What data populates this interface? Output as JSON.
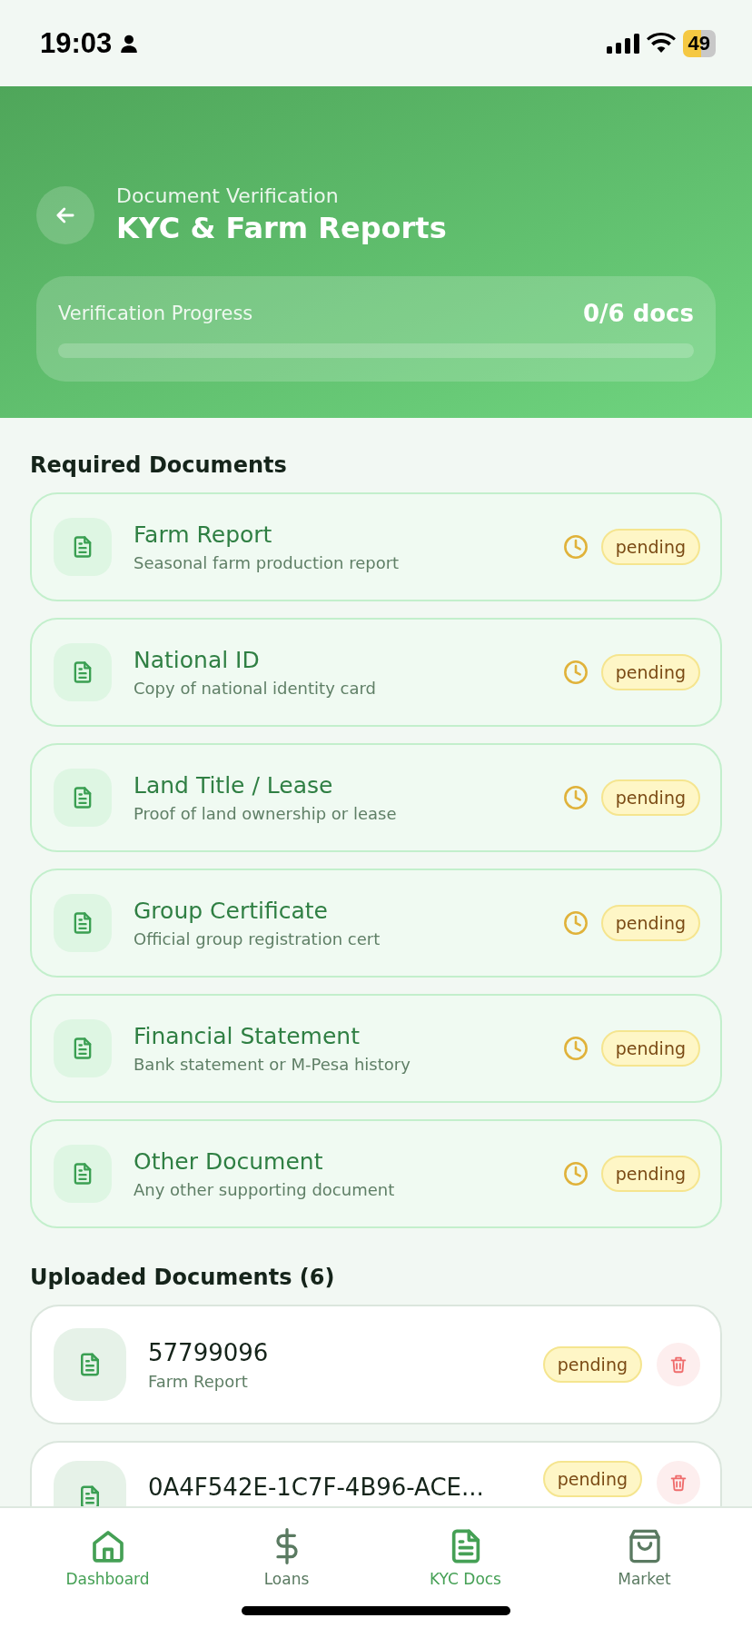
{
  "status_bar": {
    "time": "19:03",
    "battery": "49"
  },
  "header": {
    "subtitle": "Document Verification",
    "title": "KYC & Farm Reports"
  },
  "progress": {
    "label": "Verification Progress",
    "count": "0/6 docs",
    "level": 0
  },
  "required_section": {
    "title": "Required Documents"
  },
  "required_documents": [
    {
      "title": "Farm Report",
      "description": "Seasonal farm production report",
      "status": "pending"
    },
    {
      "title": "National ID",
      "description": "Copy of national identity card",
      "status": "pending"
    },
    {
      "title": "Land Title / Lease",
      "description": "Proof of land ownership or lease",
      "status": "pending"
    },
    {
      "title": "Group Certificate",
      "description": "Official group registration cert",
      "status": "pending"
    },
    {
      "title": "Financial Statement",
      "description": "Bank statement or M-Pesa history",
      "status": "pending"
    },
    {
      "title": "Other Document",
      "description": "Any other supporting document",
      "status": "pending"
    }
  ],
  "uploaded_section": {
    "title": "Uploaded Documents (6)"
  },
  "uploaded_documents": [
    {
      "name": "57799096",
      "type": "Farm Report",
      "status": "pending"
    },
    {
      "name": "0A4F542E-1C7F-4B96-ACE...",
      "status": "pending"
    }
  ],
  "tab_bar": [
    {
      "label": "Dashboard",
      "selected": true
    },
    {
      "label": "Loans",
      "selected": false
    },
    {
      "label": "KYC Docs",
      "selected": true
    },
    {
      "label": "Market",
      "selected": false
    }
  ]
}
